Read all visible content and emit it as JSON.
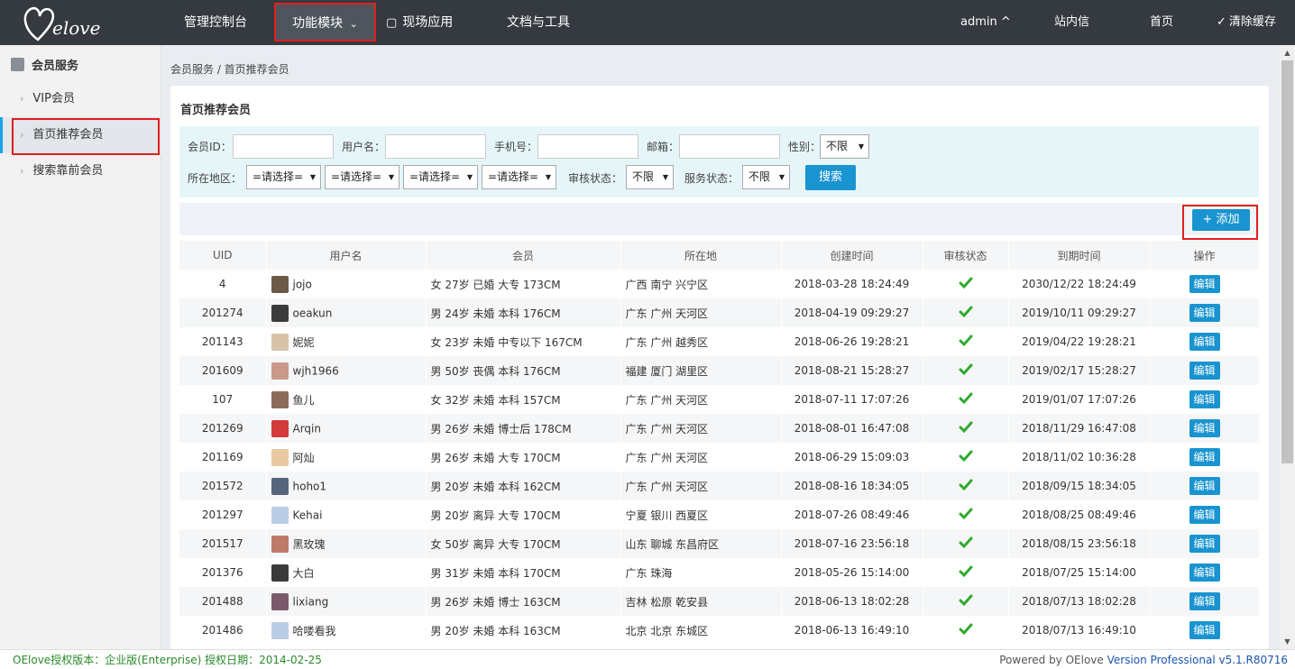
{
  "nav": {
    "items": [
      "管理控制台",
      "功能模块",
      "现场应用",
      "文档与工具"
    ],
    "user": "admin ^",
    "messages": "站内信",
    "home": "首页",
    "clear_cache": "清除缓存"
  },
  "sidebar": {
    "title": "会员服务",
    "items": [
      {
        "label": "VIP会员"
      },
      {
        "label": "首页推荐会员"
      },
      {
        "label": "搜索靠前会员"
      }
    ]
  },
  "breadcrumb": "会员服务 / 首页推荐会员",
  "panel": {
    "title": "首页推荐会员"
  },
  "filters": {
    "member_id_label": "会员ID：",
    "username_label": "用户名：",
    "phone_label": "手机号：",
    "email_label": "邮箱：",
    "gender_label": "性别：",
    "gender_value": "不限",
    "region_label": "所在地区：",
    "region_values": [
      "=请选择=",
      "=请选择=",
      "=请选择=",
      "=请选择="
    ],
    "audit_label": "审核状态：",
    "audit_value": "不限",
    "service_label": "服务状态：",
    "service_value": "不限",
    "search_button": "搜索"
  },
  "toolbar": {
    "add_button": "+ 添加"
  },
  "table": {
    "headers": [
      "UID",
      "用户名",
      "会员",
      "所在地",
      "创建时间",
      "审核状态",
      "到期时间",
      "操作"
    ],
    "edit_label": "编辑",
    "rows": [
      {
        "uid": "4",
        "name": "jojo",
        "info": "女 27岁 已婚 大专 173CM",
        "loc": "广西 南宁 兴宁区",
        "created": "2018-03-28 18:24:49",
        "expire": "2030/12/22 18:24:49",
        "expired": false,
        "avatar": "#6b5a48"
      },
      {
        "uid": "201274",
        "name": "oeakun",
        "info": "男 24岁 未婚 本科 176CM",
        "loc": "广东 广州 天河区",
        "created": "2018-04-19 09:29:27",
        "expire": "2019/10/11 09:29:27",
        "expired": false,
        "avatar": "#3c3c3c"
      },
      {
        "uid": "201143",
        "name": "妮妮",
        "info": "女 23岁 未婚 中专以下 167CM",
        "loc": "广东 广州 越秀区",
        "created": "2018-06-26 19:28:21",
        "expire": "2019/04/22 19:28:21",
        "expired": false,
        "avatar": "#d8c3a8"
      },
      {
        "uid": "201609",
        "name": "wjh1966",
        "info": "男 50岁 丧偶 本科 176CM",
        "loc": "福建 厦门 湖里区",
        "created": "2018-08-21 15:28:27",
        "expire": "2019/02/17 15:28:27",
        "expired": false,
        "avatar": "#c99a8a"
      },
      {
        "uid": "107",
        "name": "鱼儿",
        "info": "女 32岁 未婚 本科 157CM",
        "loc": "广东 广州 天河区",
        "created": "2018-07-11 17:07:26",
        "expire": "2019/01/07 17:07:26",
        "expired": false,
        "avatar": "#8a6a5a"
      },
      {
        "uid": "201269",
        "name": "Arqin",
        "info": "男 26岁 未婚 博士后 178CM",
        "loc": "广东 广州 天河区",
        "created": "2018-08-01 16:47:08",
        "expire": "2018/11/29 16:47:08",
        "expired": false,
        "avatar": "#d33a3a"
      },
      {
        "uid": "201169",
        "name": "阿灿",
        "info": "男 26岁 未婚 大专 170CM",
        "loc": "广东 广州 天河区",
        "created": "2018-06-29 15:09:03",
        "expire": "2018/11/02 10:36:28",
        "expired": false,
        "avatar": "#e8c9a0"
      },
      {
        "uid": "201572",
        "name": "hoho1",
        "info": "男 20岁 未婚 本科 162CM",
        "loc": "广东 广州 天河区",
        "created": "2018-08-16 18:34:05",
        "expire": "2018/09/15 18:34:05",
        "expired": false,
        "avatar": "#55657a"
      },
      {
        "uid": "201297",
        "name": "Kehai",
        "info": "男 20岁 离异 大专 170CM",
        "loc": "宁夏 银川 西夏区",
        "created": "2018-07-26 08:49:46",
        "expire": "2018/08/25 08:49:46",
        "expired": false,
        "avatar": "#b9cde6"
      },
      {
        "uid": "201517",
        "name": "黑玫瑰",
        "info": "女 50岁 离异 大专 170CM",
        "loc": "山东 聊城 东昌府区",
        "created": "2018-07-16 23:56:18",
        "expire": "2018/08/15 23:56:18",
        "expired": true,
        "avatar": "#c07a6a"
      },
      {
        "uid": "201376",
        "name": "大白",
        "info": "男 31岁 未婚 本科 170CM",
        "loc": "广东 珠海",
        "created": "2018-05-26 15:14:00",
        "expire": "2018/07/25 15:14:00",
        "expired": true,
        "avatar": "#3a3a3a"
      },
      {
        "uid": "201488",
        "name": "lixiang",
        "info": "男 26岁 未婚 博士 163CM",
        "loc": "吉林 松原 乾安县",
        "created": "2018-06-13 18:02:28",
        "expire": "2018/07/13 18:02:28",
        "expired": true,
        "avatar": "#7a5a6a"
      },
      {
        "uid": "201486",
        "name": "哈喽看我",
        "info": "男 20岁 未婚 本科 163CM",
        "loc": "北京 北京 东城区",
        "created": "2018-06-13 16:49:10",
        "expire": "2018/07/13 16:49:10",
        "expired": true,
        "avatar": "#b9cde6"
      }
    ]
  },
  "footer": {
    "license": "OElove授权版本：企业版(Enterprise) 授权日期：2014-02-25",
    "powered": "Powered by OElove ",
    "version": "Version Professional v5.1.R80716"
  }
}
